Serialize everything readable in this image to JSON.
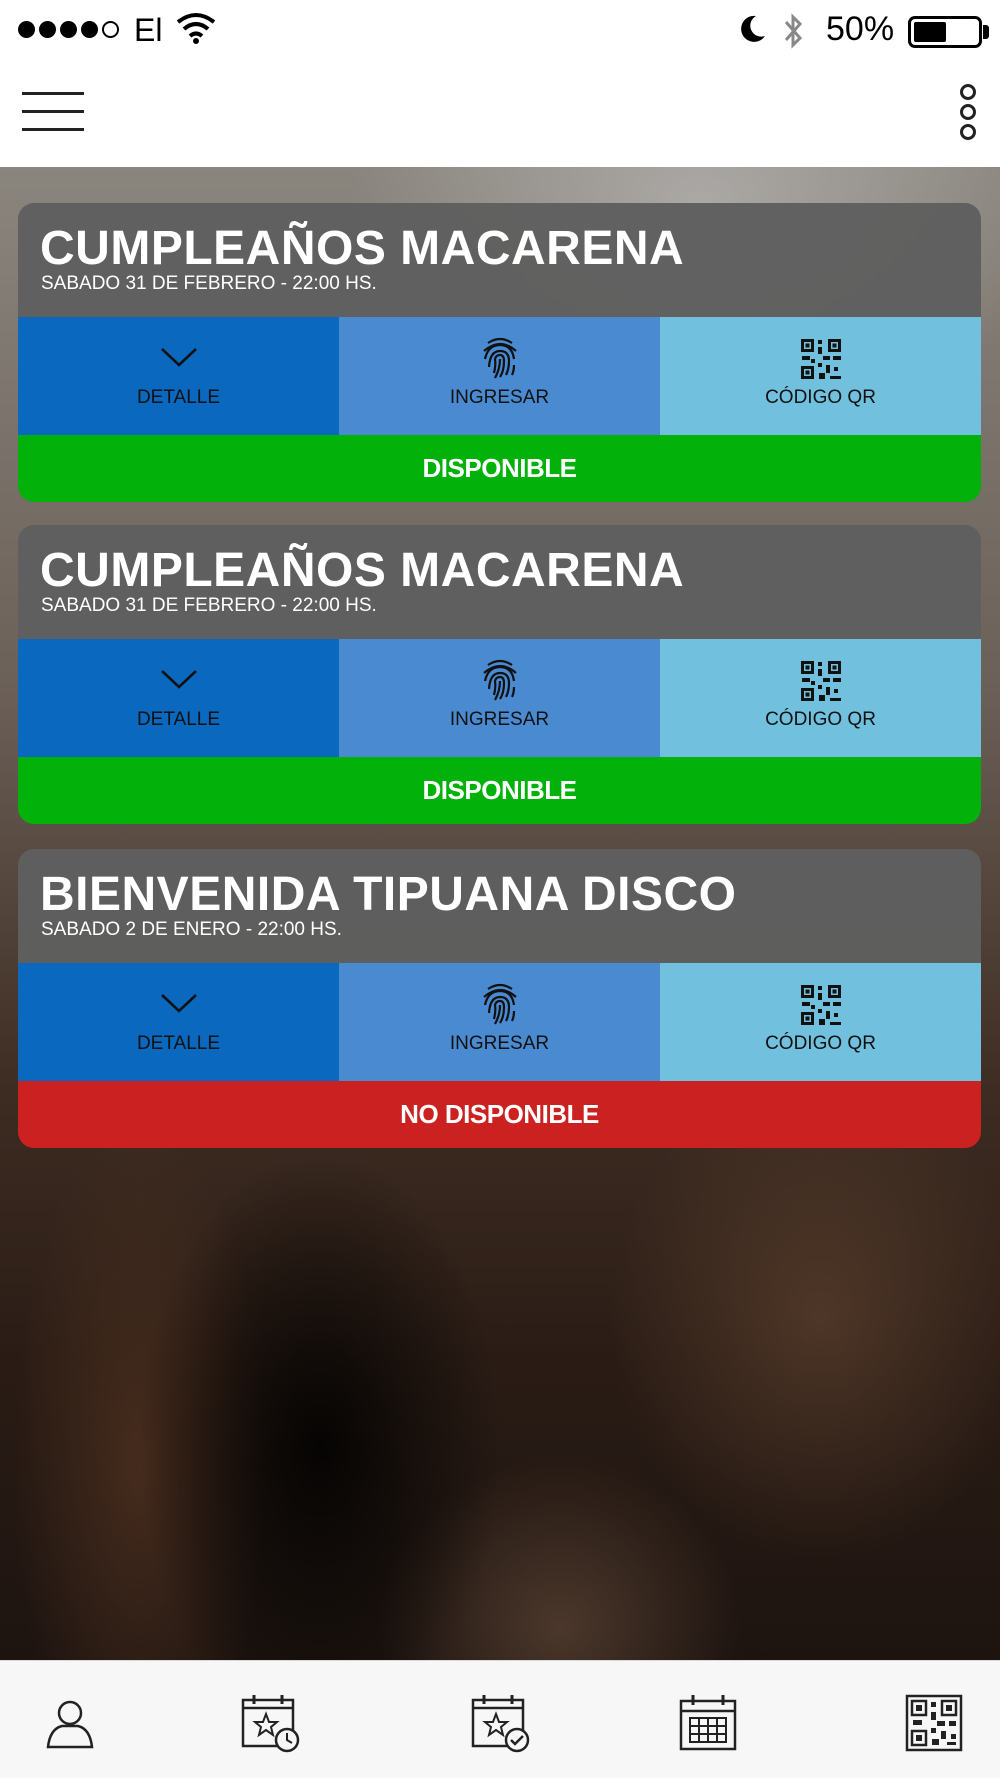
{
  "status_bar": {
    "carrier": "El",
    "battery_percent": "50%",
    "battery_level": 0.5
  },
  "nav": {
    "menu_icon": "hamburger-menu-icon",
    "more_icon": "vertical-more-icon"
  },
  "colors": {
    "detalle": "#0b68bf",
    "ingresar": "#4a8ad0",
    "qr": "#70c0de",
    "available": "#02b10a",
    "unavailable": "#cc2121"
  },
  "events": [
    {
      "title": "CUMPLEAÑOS MACARENA",
      "date": "SABADO 31 DE FEBRERO - 22:00 HS.",
      "detail_label": "DETALLE",
      "enter_label": "INGRESAR",
      "qr_label": "CÓDIGO QR",
      "status": "DISPONIBLE"
    },
    {
      "title": "CUMPLEAÑOS MACARENA",
      "date": "SABADO 31 DE FEBRERO - 22:00 HS.",
      "detail_label": "DETALLE",
      "enter_label": "INGRESAR",
      "qr_label": "CÓDIGO QR",
      "status": "DISPONIBLE"
    },
    {
      "title": "BIENVENIDA TIPUANA DISCO",
      "date": "SABADO 2 DE ENERO - 22:00 HS.",
      "detail_label": "DETALLE",
      "enter_label": "INGRESAR",
      "qr_label": "CÓDIGO QR",
      "status": "NO DISPONIBLE"
    }
  ],
  "tabs": [
    {
      "icon": "profile-icon"
    },
    {
      "icon": "upcoming-events-icon"
    },
    {
      "icon": "attended-events-icon"
    },
    {
      "icon": "calendar-icon"
    },
    {
      "icon": "qr-code-icon"
    }
  ]
}
